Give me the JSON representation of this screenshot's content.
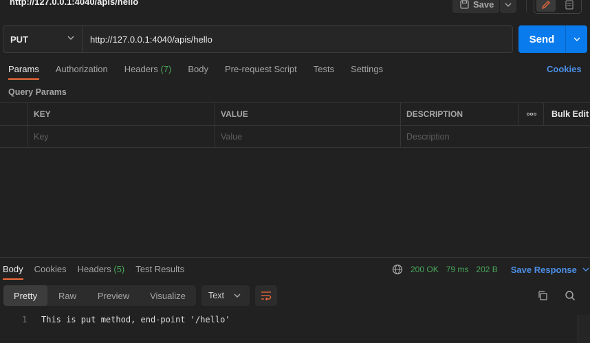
{
  "request": {
    "title": "http://127.0.0.1:4040/apis/hello",
    "save_label": "Save",
    "method": "PUT",
    "url": "http://127.0.0.1:4040/apis/hello",
    "send_label": "Send"
  },
  "request_tabs": [
    {
      "label": "Params",
      "active": true
    },
    {
      "label": "Authorization"
    },
    {
      "label": "Headers",
      "count": "(7)"
    },
    {
      "label": "Body"
    },
    {
      "label": "Pre-request Script"
    },
    {
      "label": "Tests"
    },
    {
      "label": "Settings"
    }
  ],
  "cookies_link": "Cookies",
  "query_params": {
    "title": "Query Params",
    "headers": {
      "key": "KEY",
      "value": "VALUE",
      "description": "DESCRIPTION",
      "more": "ooo",
      "bulk_edit": "Bulk Edit"
    },
    "placeholders": {
      "key": "Key",
      "value": "Value",
      "description": "Description"
    }
  },
  "response_tabs": [
    {
      "label": "Body",
      "active": true
    },
    {
      "label": "Cookies"
    },
    {
      "label": "Headers",
      "count": "(5)"
    },
    {
      "label": "Test Results"
    }
  ],
  "response_status": {
    "status": "200 OK",
    "time": "79 ms",
    "size": "202 B",
    "save_response": "Save Response"
  },
  "format_tabs": [
    "Pretty",
    "Raw",
    "Preview",
    "Visualize"
  ],
  "body_type": "Text",
  "response_body": {
    "line_number": "1",
    "text": "This is put method, end-point '/hello'"
  },
  "colors": {
    "accent": "#f26b3a",
    "send": "#097bed",
    "link": "#4c8fe6",
    "success": "#49a65a"
  }
}
